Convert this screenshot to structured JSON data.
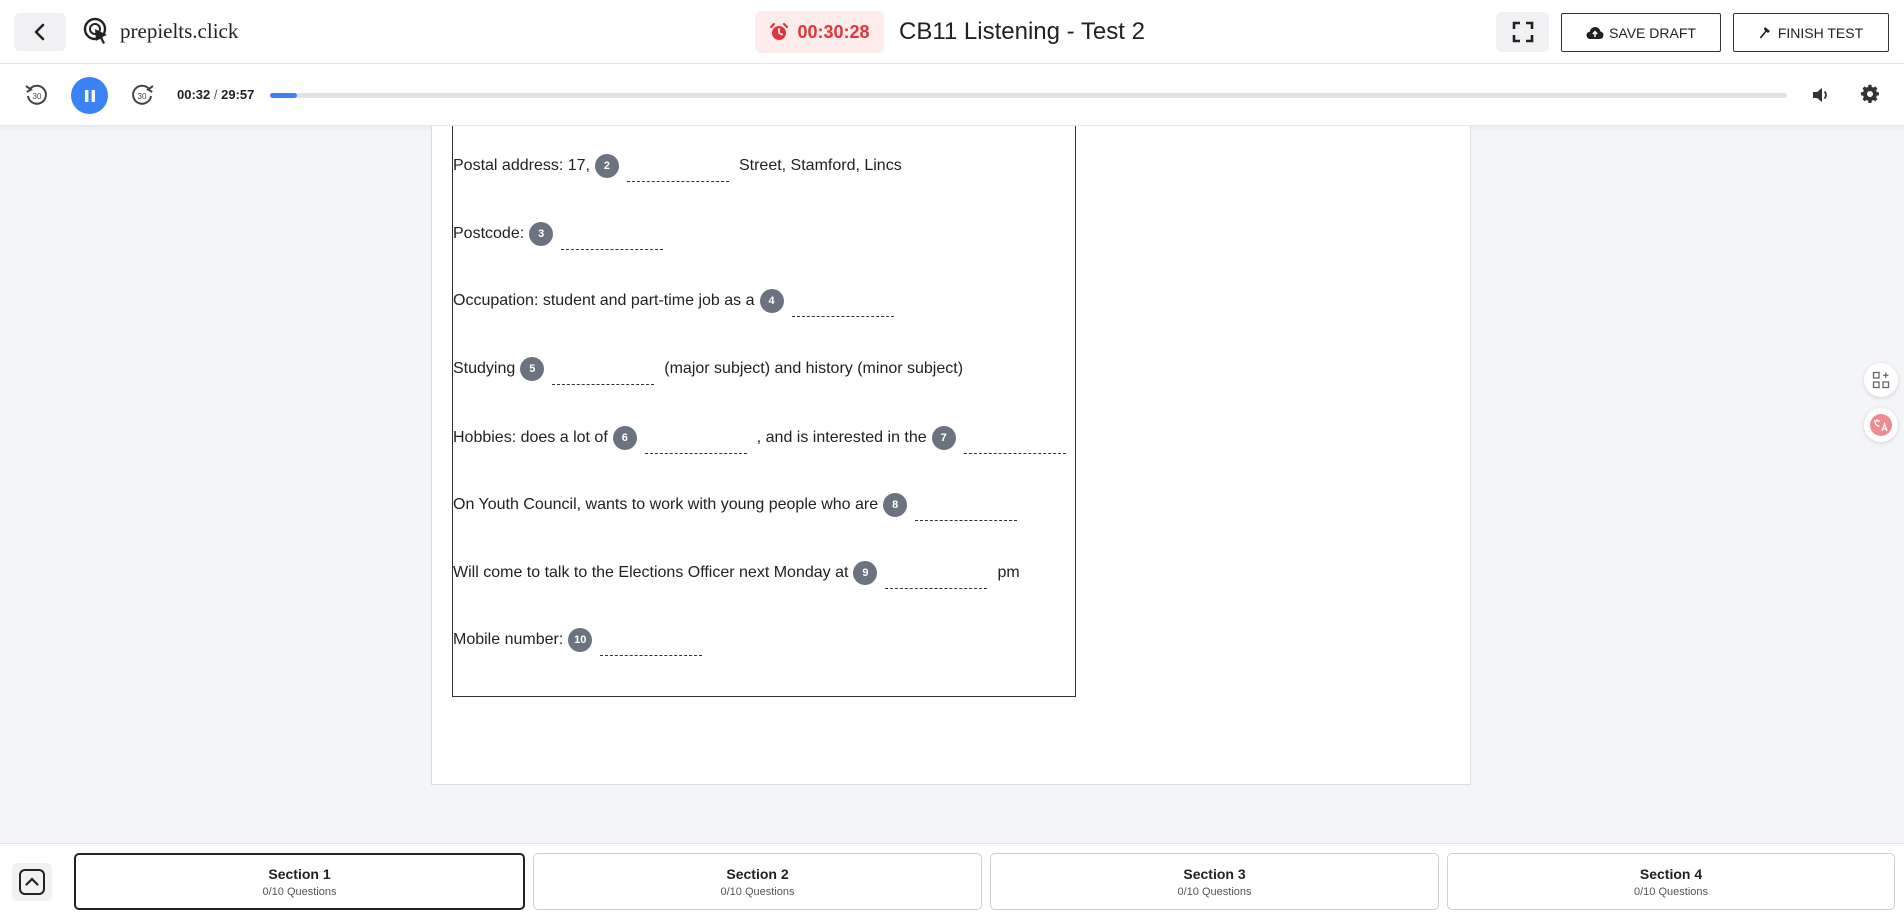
{
  "header": {
    "logo_text": "prepielts.click",
    "timer": "00:30:28",
    "title": "CB11 Listening - Test 2",
    "save_label": "SAVE DRAFT",
    "finish_label": "FINISH TEST"
  },
  "audio": {
    "current": "00:32",
    "separator": " / ",
    "total": "29:57",
    "progress_fraction": 0.018,
    "skip_seconds": "30"
  },
  "questions": [
    {
      "num": "2",
      "before": "Postal address: 17,",
      "after": "Street, Stamford, Lincs",
      "value": ""
    },
    {
      "num": "3",
      "before": "Postcode:",
      "after": "",
      "value": ""
    },
    {
      "num": "4",
      "before": "Occupation: student and part-time job as a",
      "after": "",
      "value": ""
    },
    {
      "num": "5",
      "before": "Studying",
      "after": "(major subject) and history (minor subject)",
      "value": ""
    },
    {
      "num": "6",
      "before": "Hobbies: does a lot of",
      "after": ", and is interested in the",
      "value": ""
    },
    {
      "num": "7",
      "before": "",
      "after": "",
      "value": ""
    },
    {
      "num": "8",
      "before": "On Youth Council, wants to work with young people who are",
      "after": "",
      "value": ""
    },
    {
      "num": "9",
      "before": "Will come to talk to the Elections Officer next Monday at",
      "after": "pm",
      "value": ""
    },
    {
      "num": "10",
      "before": "Mobile number:",
      "after": "",
      "value": ""
    }
  ],
  "sections": [
    {
      "name": "Section 1",
      "count": "0/10 Questions"
    },
    {
      "name": "Section 2",
      "count": "0/10 Questions"
    },
    {
      "name": "Section 3",
      "count": "0/10 Questions"
    },
    {
      "name": "Section 4",
      "count": "0/10 Questions"
    }
  ],
  "colors": {
    "accent": "#3b82f6",
    "timer": "#e0353c",
    "timer_bg": "#fdeceb",
    "badge": "#6b7280"
  }
}
